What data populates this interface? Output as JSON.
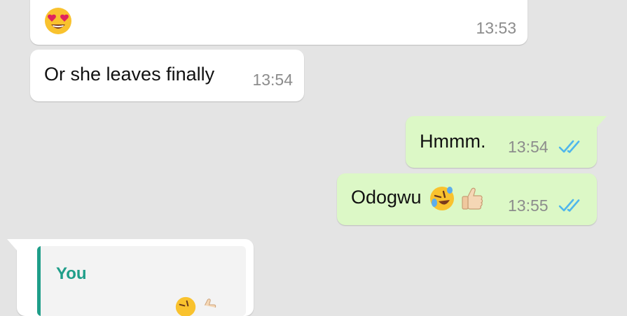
{
  "messages": {
    "m1": {
      "emoji": "smiling-face-with-heart-eyes",
      "time": "13:53"
    },
    "m2": {
      "text": "Or she leaves finally",
      "time": "13:54"
    },
    "m3": {
      "text": "Hmmm.",
      "time": "13:54",
      "status": "read-double-check"
    },
    "m4": {
      "text": "Odogwu",
      "emojis": [
        "rolling-on-floor-laughing",
        "thumbs-up"
      ],
      "time": "13:55",
      "status": "read-double-check"
    },
    "m5": {
      "quote_author": "You"
    }
  },
  "colors": {
    "background": "#e4e4e4",
    "incoming_bubble": "#ffffff",
    "outgoing_bubble": "#dcf8c6",
    "read_ticks": "#4fb6ec",
    "quote_accent": "#1f9e89",
    "timestamp": "#8c8c8c"
  }
}
